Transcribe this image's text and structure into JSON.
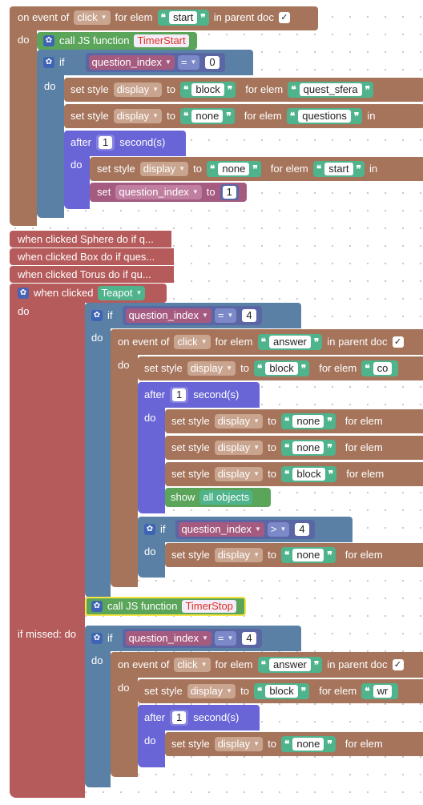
{
  "colors": {
    "event": "#a5745b",
    "style": "#b0714f",
    "logic": "#5b80a5",
    "timer": "#6965d6",
    "var": "#a55b80",
    "green": "#5ba55b",
    "hat": "#b55b5b",
    "math": "#5b67a5",
    "string": "#4fb38c"
  },
  "top": {
    "on_event": "on event of",
    "event_val": "click",
    "for_elem": "for elem",
    "elem": "start",
    "in_parent": "in parent doc",
    "check": "✓",
    "do": "do",
    "call_js": "call JS function",
    "fn1": "TimerStart",
    "if": "if",
    "qi": "question_index",
    "eq": "=",
    "zero": "0",
    "set_style": "set style",
    "display": "display",
    "to": "to",
    "block": "block",
    "none": "none",
    "quest_sfera": "quest_sfera",
    "questions": "questions",
    "in": "in",
    "after": "after",
    "one": "1",
    "seconds": "second(s)",
    "set": "set",
    "start": "start"
  },
  "collapsed": [
    "when clicked Sphere do if q...",
    "when clicked Box do if ques...",
    "when clicked Torus do if qu..."
  ],
  "teapot": {
    "when_clicked": "when clicked",
    "obj": "Teapot",
    "do": "do",
    "four": "4",
    "gt": ">",
    "answer": "answer",
    "co": "co",
    "show": "show",
    "all_objects": "all objects",
    "call_js": "call JS function",
    "fn2": "TimerStop",
    "if_missed": "if missed: do",
    "wr": "wr"
  }
}
